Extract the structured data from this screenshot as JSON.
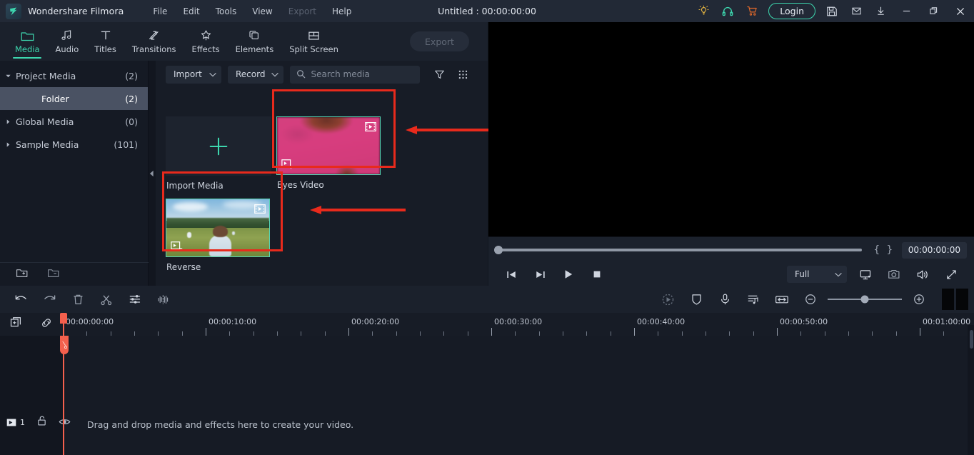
{
  "app": {
    "brand": "Wondershare Filmora",
    "document_title": "Untitled : 00:00:00:00"
  },
  "menubar": {
    "items": [
      {
        "label": "File",
        "disabled": false
      },
      {
        "label": "Edit",
        "disabled": false
      },
      {
        "label": "Tools",
        "disabled": false
      },
      {
        "label": "View",
        "disabled": false
      },
      {
        "label": "Export",
        "disabled": true
      },
      {
        "label": "Help",
        "disabled": false
      }
    ]
  },
  "titlebar_right": {
    "icons": [
      "lightbulb-icon",
      "headset-icon",
      "cart-icon"
    ],
    "login_label": "Login",
    "actions": [
      "save-icon",
      "mail-icon",
      "download-icon"
    ],
    "window": [
      "minimize-icon",
      "restore-icon",
      "close-icon"
    ],
    "colors": {
      "lightbulb": "#e3b341",
      "headset": "#3dd6ae",
      "cart": "#e0682a",
      "login_border": "#3dd6ae"
    }
  },
  "toolbar": {
    "tabs": [
      {
        "label": "Media",
        "icon": "folder-icon",
        "active": true
      },
      {
        "label": "Audio",
        "icon": "music-note-icon",
        "active": false
      },
      {
        "label": "Titles",
        "icon": "text-t-icon",
        "active": false
      },
      {
        "label": "Transitions",
        "icon": "transitions-arrows-icon",
        "active": false
      },
      {
        "label": "Effects",
        "icon": "effects-star-icon",
        "active": false
      },
      {
        "label": "Elements",
        "icon": "elements-layers-icon",
        "active": false
      },
      {
        "label": "Split Screen",
        "icon": "split-screen-icon",
        "active": false
      }
    ],
    "export_label": "Export",
    "export_disabled": true,
    "accent": "#3dd6ae"
  },
  "sidebar": {
    "items": [
      {
        "label": "Project Media",
        "count": "(2)",
        "expanded": true,
        "selected": false,
        "indent": false
      },
      {
        "label": "Folder",
        "count": "(2)",
        "expanded": false,
        "selected": true,
        "indent": true
      },
      {
        "label": "Global Media",
        "count": "(0)",
        "expanded": false,
        "selected": false,
        "indent": false
      },
      {
        "label": "Sample Media",
        "count": "(101)",
        "expanded": false,
        "selected": false,
        "indent": false
      }
    ],
    "footer_icons": [
      "new-folder-icon",
      "remove-folder-icon"
    ]
  },
  "media_panel": {
    "import_button": "Import",
    "record_button": "Record",
    "search_placeholder": "Search media",
    "search_value": "",
    "filter_icon": "filter-funnel-icon",
    "grid_icon": "grid-view-icon",
    "import_cell_label": "Import Media",
    "items": [
      {
        "label": "Eyes Video",
        "selected": true,
        "badge": "film-strip-icon",
        "preview_badge": "preview-p-icon"
      },
      {
        "label": "Reverse",
        "selected": true,
        "badge": "film-strip-icon",
        "preview_badge": "preview-p-icon"
      }
    ]
  },
  "annotations": {
    "color": "#e82a1c",
    "boxes": [
      {
        "target": "Eyes Video"
      },
      {
        "target": "Reverse"
      }
    ],
    "arrows": [
      {
        "points_to": "Eyes Video"
      },
      {
        "points_to": "Reverse"
      }
    ]
  },
  "player": {
    "timecode": "00:00:00:00",
    "mark_in": "{",
    "mark_out": "}",
    "position_percent": 0,
    "controls": [
      "prev-frame-icon",
      "next-frame-icon",
      "play-icon",
      "stop-icon"
    ],
    "quality_label": "Full",
    "right_icons": [
      "screen-cast-icon",
      "snapshot-camera-icon",
      "volume-icon",
      "fullscreen-icon"
    ]
  },
  "timeline_toolbar": {
    "left_icons": [
      "undo-icon",
      "redo-icon",
      "delete-trash-icon",
      "split-scissors-icon",
      "adjust-sliders-icon",
      "audio-waveform-icon"
    ],
    "right_icons": [
      "motion-tracking-icon",
      "stabilization-shield-icon",
      "voiceover-mic-icon",
      "beat-detect-icon",
      "fit-timeline-icon"
    ],
    "zoom_out_icon": "zoom-out-icon",
    "zoom_in_icon": "zoom-in-icon",
    "zoom_value_percent": 50
  },
  "ruler": {
    "head_icons": [
      "add-track-icon",
      "link-chain-icon"
    ],
    "labels": [
      "00:00:00:00",
      "00:00:10:00",
      "00:00:20:00",
      "00:00:30:00",
      "00:00:40:00",
      "00:00:50:00",
      "00:01:00:00"
    ],
    "playhead_position": "00:00:00:00"
  },
  "timeline": {
    "track_number": "1",
    "track_icons": [
      "video-track-icon",
      "unlock-icon",
      "eye-visible-icon"
    ],
    "drop_hint": "Drag and drop media and effects here to create your video."
  }
}
